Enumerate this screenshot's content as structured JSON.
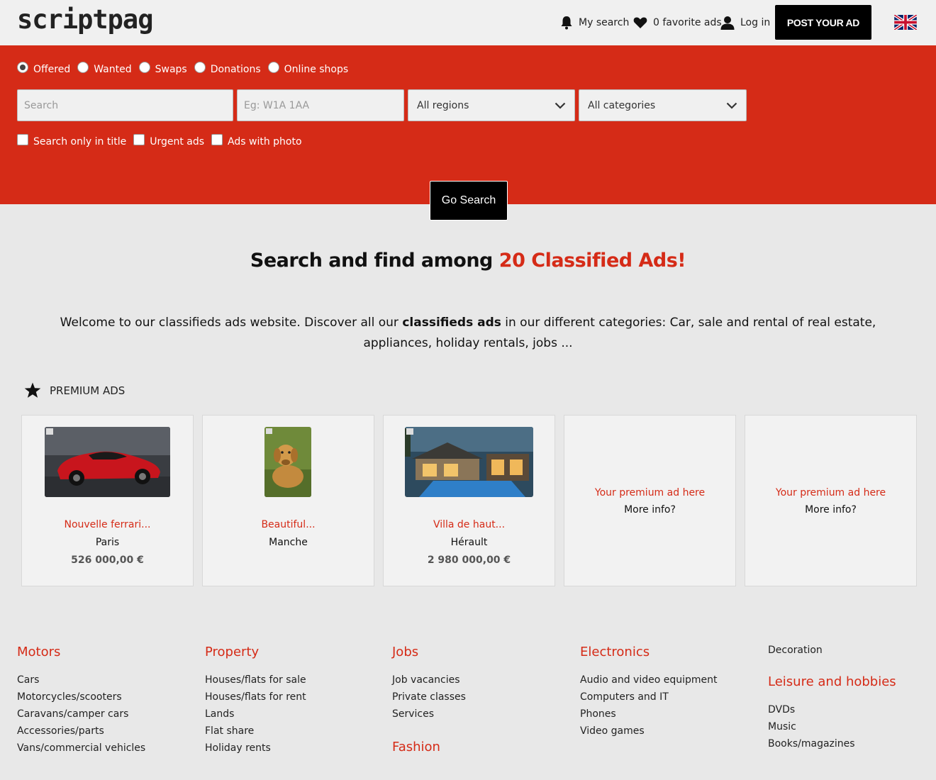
{
  "header": {
    "logo": "scriptpag",
    "my_search": "My search",
    "favorites": "0 favorite ads",
    "login": "Log in",
    "post_ad": "POST YOUR AD"
  },
  "search": {
    "types": [
      "Offered",
      "Wanted",
      "Swaps",
      "Donations",
      "Online shops"
    ],
    "selected_type": "Offered",
    "search_placeholder": "Search",
    "postcode_placeholder": "Eg: W1A 1AA",
    "region": "All regions",
    "category": "All categories",
    "options": [
      "Search only in title",
      "Urgent ads",
      "Ads with photo"
    ],
    "go_button": "Go Search"
  },
  "main": {
    "headline_prefix": "Search and find among ",
    "headline_accent": "20 Classified Ads!",
    "intro_1": "Welcome to our classifieds ads website. Discover all our ",
    "intro_bold": "classifieds ads",
    "intro_2": " in our different categories: Car, sale and rental of real estate, appliances, holiday rentals, jobs ...",
    "premium_label": "PREMIUM ADS"
  },
  "premium_ads": [
    {
      "title": "Nouvelle ferrari...",
      "location": "Paris",
      "price": "526 000,00 €",
      "image": "red-sports-car"
    },
    {
      "title": "Beautiful...",
      "location": "Manche",
      "price": "",
      "image": "dog"
    },
    {
      "title": "Villa de haut...",
      "location": "Hérault",
      "price": "2 980 000,00 €",
      "image": "villa-pool"
    },
    {
      "title": "Your premium ad here",
      "more": "More info?"
    },
    {
      "title": "Your premium ad here",
      "more": "More info?"
    }
  ],
  "categories": {
    "motors": {
      "title": "Motors",
      "items": [
        "Cars",
        "Motorcycles/scooters",
        "Caravans/camper cars",
        "Accessories/parts",
        "Vans/commercial vehicles"
      ]
    },
    "property": {
      "title": "Property",
      "items": [
        "Houses/flats for sale",
        "Houses/flats for rent",
        "Lands",
        "Flat share",
        "Holiday rents"
      ]
    },
    "jobs": {
      "title": "Jobs",
      "items": [
        "Job vacancies",
        "Private classes",
        "Services"
      ]
    },
    "fashion": {
      "title": "Fashion"
    },
    "electronics": {
      "title": "Electronics",
      "items": [
        "Audio and video equipment",
        "Computers and IT",
        "Phones",
        "Video games"
      ]
    },
    "decoration": "Decoration",
    "leisure": {
      "title": "Leisure and hobbies",
      "items": [
        "DVDs",
        "Music",
        "Books/magazines"
      ]
    }
  },
  "colors": {
    "accent": "#d52b17",
    "dark": "#000000",
    "page_bg": "#e8e8e8"
  }
}
